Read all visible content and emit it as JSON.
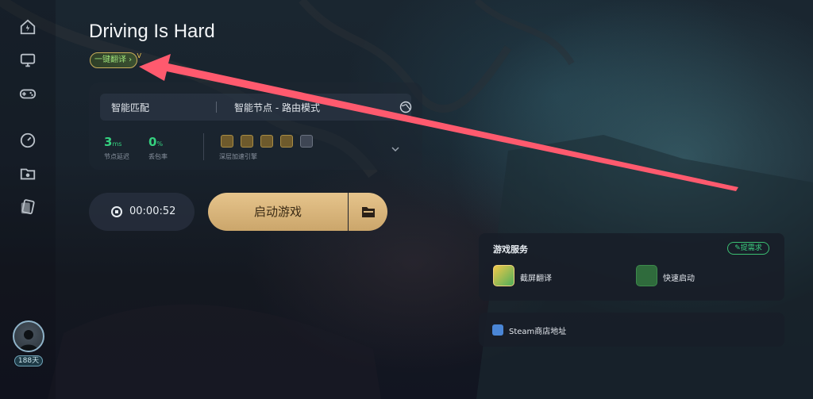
{
  "game": {
    "title": "Driving Is Hard",
    "translate_label": "一键翻译 ›",
    "vip_mark": "V"
  },
  "route": {
    "mode": "智能匹配",
    "node": "智能节点 - 路由模式",
    "latency_value": "3",
    "latency_unit": "ms",
    "latency_label": "节点延迟",
    "loss_value": "0",
    "loss_unit": "%",
    "loss_label": "丢包率",
    "accel_label": "深层加速引擎"
  },
  "session": {
    "timer": "00:00:52",
    "launch_label": "启动游戏"
  },
  "services": {
    "title": "游戏服务",
    "demand_label": "提需求",
    "items": [
      {
        "label": "截屏翻译",
        "icon": "screenshot-translate-icon"
      },
      {
        "label": "快速启动",
        "icon": "quick-launch-icon"
      }
    ]
  },
  "steam": {
    "label": "Steam商店地址"
  },
  "user": {
    "vip_days": "188天"
  },
  "colors": {
    "accent_green": "#35d07f",
    "gold": "#d9b67c",
    "arrow_red": "#ff5a6e"
  }
}
